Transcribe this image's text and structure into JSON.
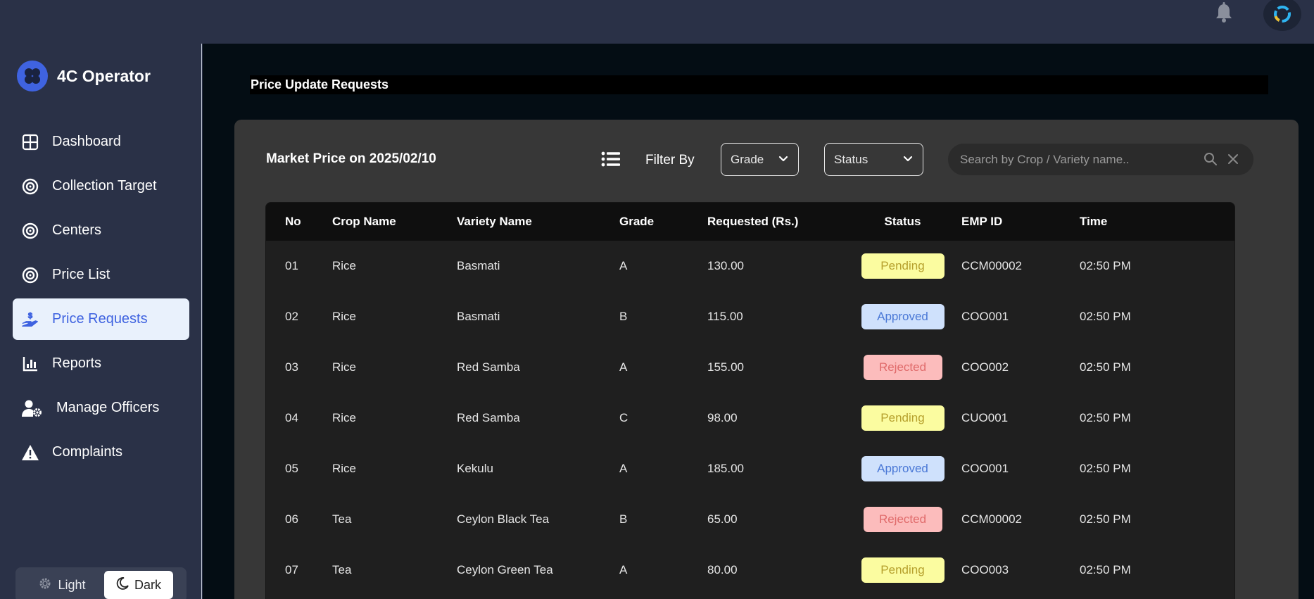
{
  "app": {
    "title": "4C Operator"
  },
  "sidebar": {
    "items": [
      {
        "label": "Dashboard",
        "icon": "dashboard-grid-icon",
        "active": false
      },
      {
        "label": "Collection Target",
        "icon": "target-icon",
        "active": false
      },
      {
        "label": "Centers",
        "icon": "target-icon",
        "active": false
      },
      {
        "label": "Price List",
        "icon": "target-icon",
        "active": false
      },
      {
        "label": "Price Requests",
        "icon": "hand-dollar-icon",
        "active": true
      },
      {
        "label": "Reports",
        "icon": "bar-chart-icon",
        "active": false
      },
      {
        "label": "Manage Officers",
        "icon": "user-gear-icon",
        "active": false
      },
      {
        "label": "Complaints",
        "icon": "warning-triangle-icon",
        "active": false
      }
    ],
    "theme": {
      "light_label": "Light",
      "dark_label": "Dark",
      "selected": "Dark"
    }
  },
  "page": {
    "title": "Price Update Requests"
  },
  "market": {
    "title": "Market Price on 2025/02/10",
    "filter_label": "Filter By",
    "grade_select": "Grade",
    "status_select": "Status",
    "search_placeholder": "Search by Crop / Variety name.."
  },
  "table": {
    "headers": {
      "no": "No",
      "crop": "Crop Name",
      "variety": "Variety Name",
      "grade": "Grade",
      "requested": "Requested (Rs.)",
      "status": "Status",
      "emp": "EMP ID",
      "time": "Time"
    },
    "rows": [
      {
        "no": "01",
        "crop": "Rice",
        "variety": "Basmati",
        "grade": "A",
        "requested": "130.00",
        "status": "Pending",
        "emp": "CCM00002",
        "time": "02:50 PM"
      },
      {
        "no": "02",
        "crop": "Rice",
        "variety": "Basmati",
        "grade": "B",
        "requested": "115.00",
        "status": "Approved",
        "emp": "COO001",
        "time": "02:50 PM"
      },
      {
        "no": "03",
        "crop": "Rice",
        "variety": "Red Samba",
        "grade": "A",
        "requested": "155.00",
        "status": "Rejected",
        "emp": "COO002",
        "time": "02:50 PM"
      },
      {
        "no": "04",
        "crop": "Rice",
        "variety": "Red Samba",
        "grade": "C",
        "requested": "98.00",
        "status": "Pending",
        "emp": "CUO001",
        "time": "02:50 PM"
      },
      {
        "no": "05",
        "crop": "Rice",
        "variety": "Kekulu",
        "grade": "A",
        "requested": "185.00",
        "status": "Approved",
        "emp": "COO001",
        "time": "02:50 PM"
      },
      {
        "no": "06",
        "crop": "Tea",
        "variety": "Ceylon Black Tea",
        "grade": "B",
        "requested": "65.00",
        "status": "Rejected",
        "emp": "CCM00002",
        "time": "02:50 PM"
      },
      {
        "no": "07",
        "crop": "Tea",
        "variety": "Ceylon Green Tea",
        "grade": "A",
        "requested": "80.00",
        "status": "Pending",
        "emp": "COO003",
        "time": "02:50 PM"
      }
    ]
  },
  "colors": {
    "accent": "#3f63e0",
    "pending_bg": "#fbfca0",
    "approved_bg": "#cfe1fc",
    "rejected_bg": "#fcbcbc"
  }
}
